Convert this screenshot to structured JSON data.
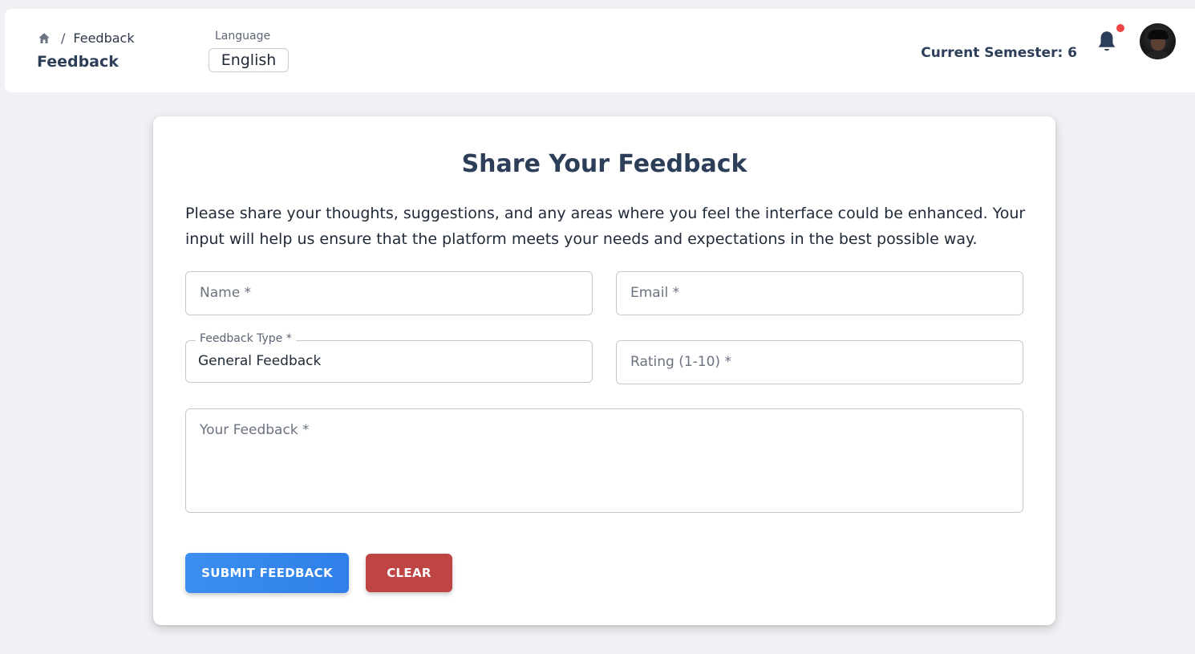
{
  "header": {
    "breadcrumb": {
      "current": "Feedback",
      "separator": "/"
    },
    "page_title": "Feedback",
    "language": {
      "label": "Language",
      "selected": "English"
    },
    "semester": "Current Semester: 6",
    "notification_dot": true
  },
  "form": {
    "title": "Share Your Feedback",
    "description": "Please share your thoughts, suggestions, and any areas where you feel the interface could be enhanced. Your input will help us ensure that the platform meets your needs and expectations in the best possible way.",
    "fields": {
      "name": {
        "placeholder": "Name *"
      },
      "email": {
        "placeholder": "Email *"
      },
      "feedback_type": {
        "label": "Feedback Type *",
        "value": "General Feedback"
      },
      "rating": {
        "placeholder": "Rating (1-10) *"
      },
      "feedback": {
        "placeholder": "Your Feedback *"
      }
    },
    "buttons": {
      "submit": "SUBMIT FEEDBACK",
      "clear": "CLEAR"
    }
  },
  "colors": {
    "submit": "#2f7fe8",
    "clear": "#bf4545",
    "title": "#2d3e58",
    "notification": "#ef4444"
  },
  "icons": [
    "home-icon",
    "bell-icon",
    "avatar"
  ]
}
